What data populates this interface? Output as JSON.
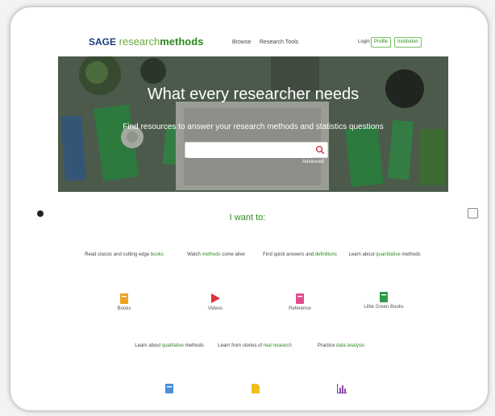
{
  "header": {
    "logo_sage": "SAGE",
    "logo_research": "research",
    "logo_methods": "methods",
    "nav": [
      "Browse",
      "Research Tools"
    ],
    "login": "Login",
    "profile": "Profile",
    "institution": "Institution"
  },
  "hero": {
    "title": "What every researcher needs",
    "subtitle": "Find resources to answer your research methods and statistics questions",
    "search_placeholder": "",
    "advanced": "Advanced"
  },
  "want": {
    "heading": "I want to:",
    "tasks": [
      {
        "pre": "Read classic and cutting edge ",
        "link": "books",
        "post": "",
        "label": "Books",
        "icon": "book-icon"
      },
      {
        "pre": "Watch ",
        "link": "methods",
        "post": " come alive",
        "label": "Videos",
        "icon": "play-icon"
      },
      {
        "pre": "Find quick answers and ",
        "link": "definitions",
        "post": "",
        "label": "Reference",
        "icon": "reference-book-icon"
      },
      {
        "pre": "Learn about ",
        "link": "quantitative",
        "post": " methods",
        "label": "Little Green Books",
        "icon": "green-book-icon"
      },
      {
        "pre": "Learn about ",
        "link": "qualitative",
        "post": " methods",
        "label": "",
        "icon": "qualitative-book-icon"
      },
      {
        "pre": "Learn from stories of ",
        "link": "real research",
        "post": "",
        "label": "",
        "icon": "case-document-icon"
      },
      {
        "pre": "Practice ",
        "link": "data analysis",
        "post": "",
        "label": "",
        "icon": "bar-chart-icon"
      }
    ]
  },
  "colors": {
    "accent_green": "#2e8a1f",
    "brand_blue": "#1a3d7a",
    "books": "#f0a020",
    "videos": "#e0303a",
    "reference": "#e04c8c",
    "little_green_books": "#2e9a4a",
    "qualitative": "#4a90d9",
    "cases": "#f0c020",
    "datasets": "#8a4ab0"
  }
}
